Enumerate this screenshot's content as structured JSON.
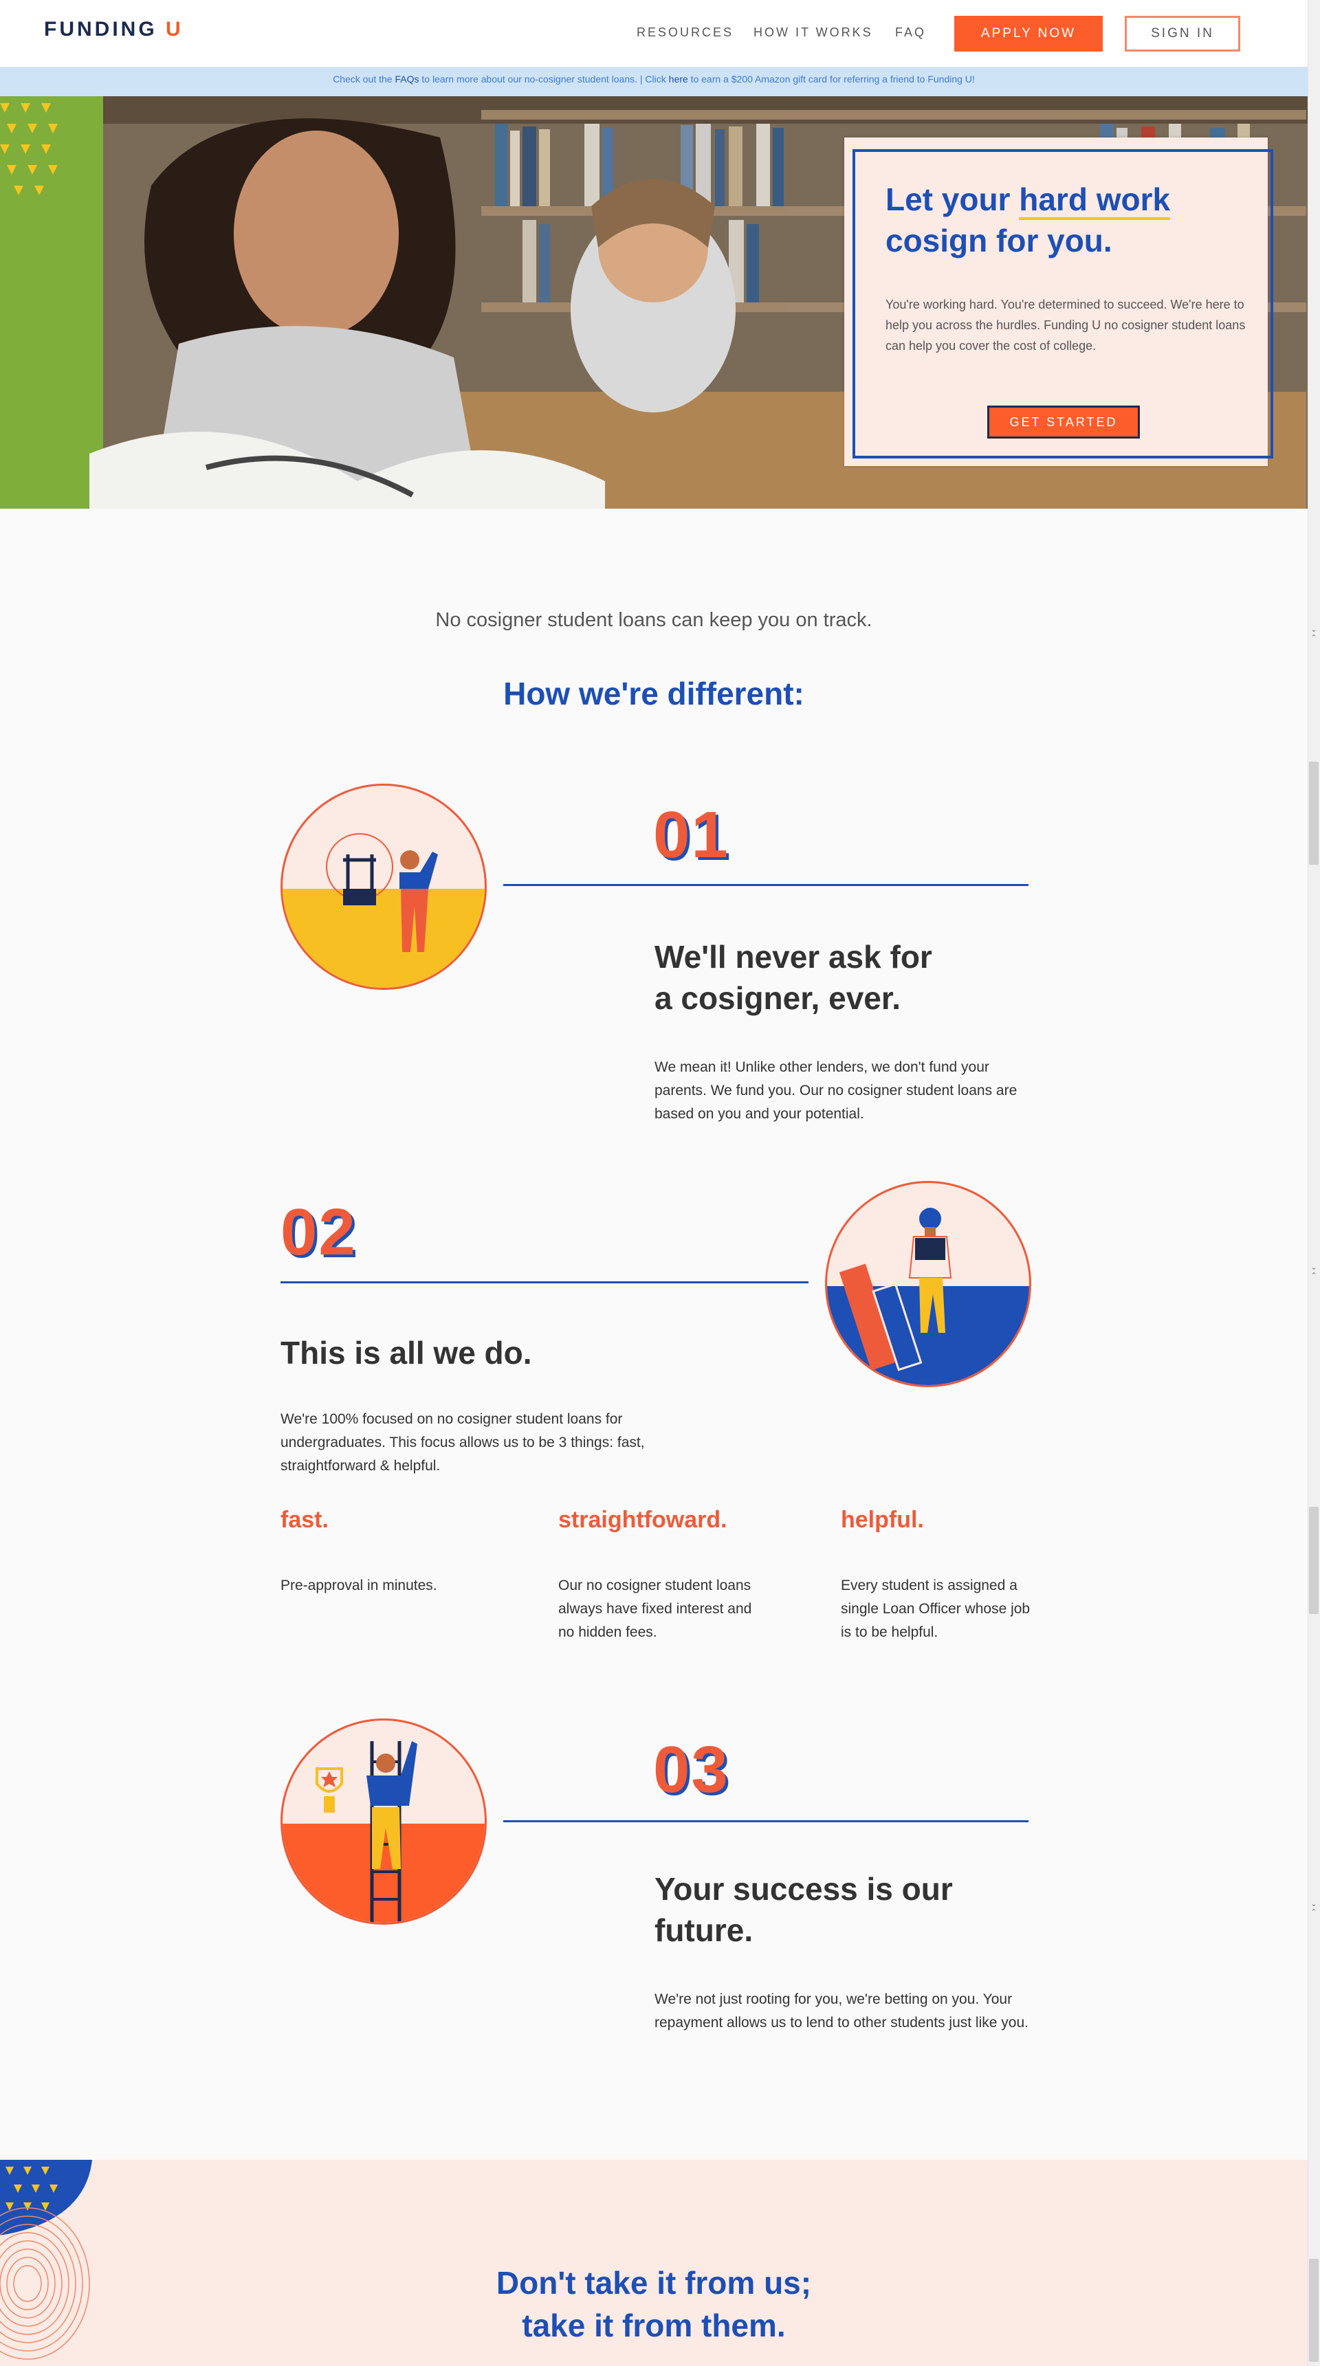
{
  "header": {
    "logo_main": "FUNDING",
    "logo_accent": "U",
    "nav": [
      "RESOURCES",
      "HOW IT WORKS",
      "FAQ"
    ],
    "apply_label": "APPLY NOW",
    "sign_in_label": "SIGN IN"
  },
  "banner": {
    "part1": "Check out the ",
    "faq_link": "FAQs",
    "part2": " to learn more about our no-cosigner student loans.  |  Click ",
    "here_link": "here",
    "part3": " to earn a $200 Amazon gift card for referring a friend to Funding U!"
  },
  "hero": {
    "title_pre": "Let your ",
    "title_highlight": "hard work",
    "title_post": "cosign for you.",
    "text": "You're working hard. You're determined to succeed. We're here to help you across the hurdles. Funding U no cosigner student loans can help you cover the cost of college.",
    "cta": "GET STARTED"
  },
  "intro": {
    "tagline": "No cosigner student loans can keep you on track.",
    "heading": "How we're different:"
  },
  "features": [
    {
      "num": "01",
      "title_l1": "We'll never ask for",
      "title_l2": "a cosigner, ever.",
      "text": "We mean it! Unlike other lenders, we don't fund your parents. We fund you. Our no cosigner student loans are based on you and your potential."
    },
    {
      "num": "02",
      "title_l1": "This is all we do.",
      "text": "We're 100% focused on no cosigner student loans for undergraduates. This focus allows us to be 3 things: fast, straightforward & helpful."
    },
    {
      "num": "03",
      "title_l1": "Your success is our",
      "title_l2": "future.",
      "text": "We're not just rooting for you, we're betting on you. Your repayment allows us to lend to other students just like you."
    }
  ],
  "qualities": [
    {
      "title": "fast.",
      "text": "Pre-approval in minutes."
    },
    {
      "title": "straightfoward.",
      "text": "Our no cosigner student loans always have fixed interest and no hidden fees."
    },
    {
      "title": "helpful.",
      "text": "Every student is assigned a single Loan Officer whose job is to be helpful."
    }
  ],
  "testimonials": {
    "title_l1": "Don't take it from us;",
    "title_l2": "take it from them."
  },
  "colors": {
    "accent_orange": "#fd5d2a",
    "brand_blue": "#1d4fb5",
    "navy": "#1b2a4e",
    "yellow": "#f4c520",
    "peach": "#fceae4"
  }
}
